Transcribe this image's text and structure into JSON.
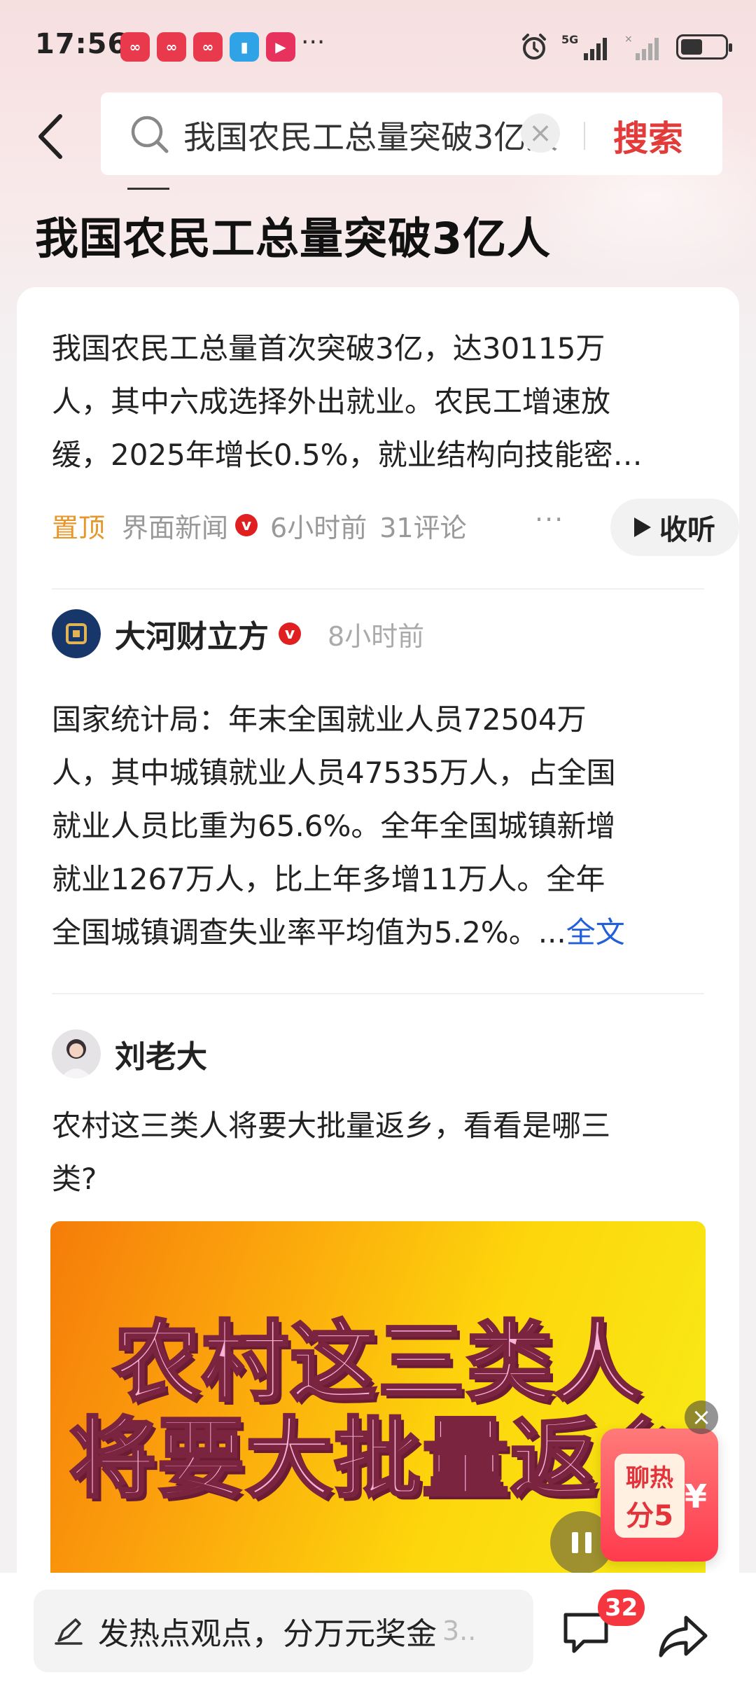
{
  "status_bar": {
    "time": "17:56",
    "app_icons": [
      "app-red-1",
      "app-red-2",
      "app-red-3",
      "book-icon",
      "video-icon"
    ],
    "more": "···",
    "network": "5G"
  },
  "search": {
    "query": "我国农民工总量突破3亿人",
    "button_label": "搜索"
  },
  "page_title": "我国农民工总量突破3亿人",
  "summary": {
    "lines": [
      "我国农民工总量首次突破3亿，达30115万",
      "人，其中六成选择外出就业。农民工增速放",
      "缓，2025年增长0.5%，就业结构向技能密…"
    ],
    "pin_label": "置顶",
    "source": "界面新闻",
    "time_ago": "6小时前",
    "comments": "31评论",
    "more": "···",
    "listen_label": "收听"
  },
  "post1": {
    "author": "大河财立方",
    "time_ago": "8小时前",
    "lines": [
      "国家统计局：年末全国就业人员72504万",
      "人，其中城镇就业人员47535万人，占全国",
      "就业人员比重为65.6%。全年全国城镇新增",
      "就业1267万人，比上年多增11万人。全年",
      "全国城镇调查失业率平均值为5.2%。..."
    ],
    "full_text_link": "全文"
  },
  "post2": {
    "author": "刘老大",
    "lines": [
      "农村这三类人将要大批量返乡，看看是哪三",
      "类?"
    ],
    "video_title_lines": [
      "农村这三类人",
      "将要大批量返乡"
    ]
  },
  "widget": {
    "line1": "聊热",
    "line2": "分5",
    "yen": "¥",
    "close": "×"
  },
  "bottom_bar": {
    "comment_placeholder": "发热点观点，分万元奖金",
    "comment_suffix": "3..",
    "comment_badge": "32"
  },
  "colors": {
    "accent_red": "#e33a3a",
    "pin_orange": "#e7962a",
    "link_blue": "#2160d8",
    "badge_red": "#f5363f"
  }
}
